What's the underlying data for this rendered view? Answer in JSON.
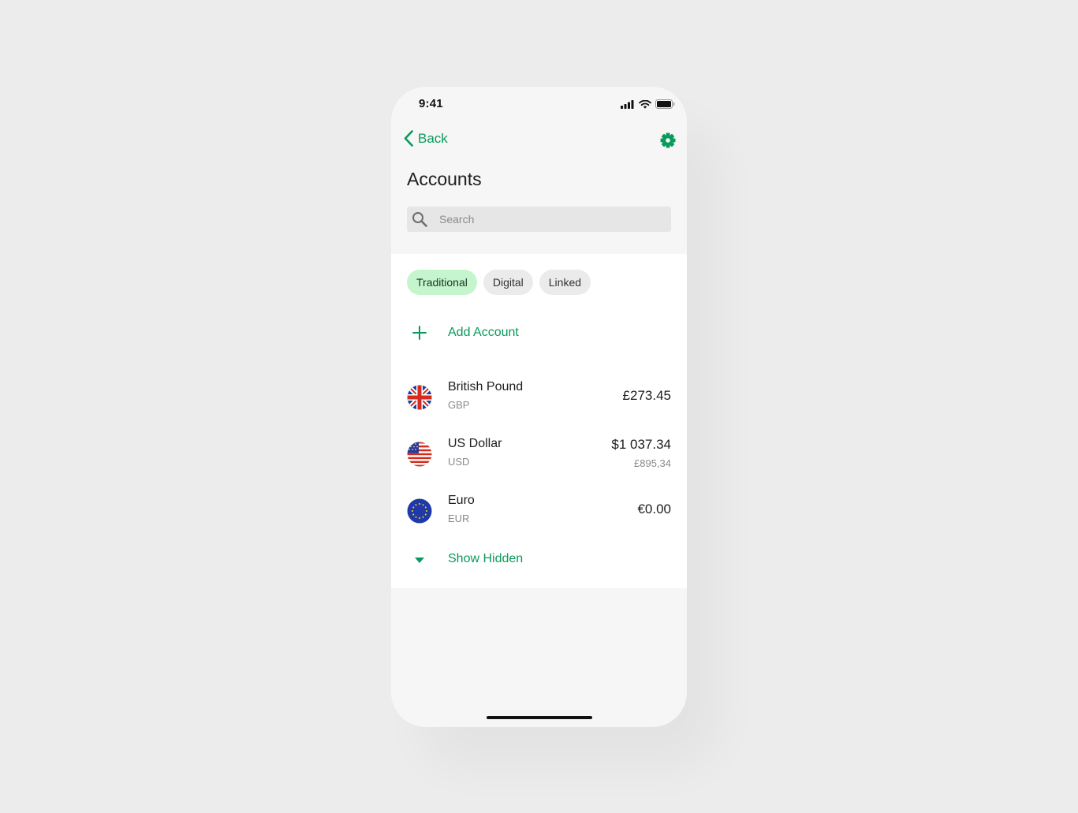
{
  "status_bar": {
    "time": "9:41",
    "icons": [
      "cellular-signal-icon",
      "wifi-icon",
      "battery-icon"
    ]
  },
  "nav": {
    "back_label": "Back",
    "back_icon": "chevron-left-icon",
    "settings_icon": "gear-icon"
  },
  "page": {
    "title": "Accounts"
  },
  "search": {
    "placeholder": "Search",
    "value": "",
    "icon": "search-icon"
  },
  "filters": {
    "chips": [
      {
        "label": "Traditional",
        "selected": true
      },
      {
        "label": "Digital",
        "selected": false
      },
      {
        "label": "Linked",
        "selected": false
      }
    ]
  },
  "add_account": {
    "label": "Add Account",
    "icon": "plus-icon"
  },
  "accounts": [
    {
      "name": "British Pound",
      "code": "GBP",
      "amount": "£273.45",
      "secondary": "",
      "flag": "uk-flag-icon"
    },
    {
      "name": "US Dollar",
      "code": "USD",
      "amount": "$1 037.34",
      "secondary": "£895,34",
      "flag": "us-flag-icon"
    },
    {
      "name": "Euro",
      "code": "EUR",
      "amount": "€0.00",
      "secondary": "",
      "flag": "eu-flag-icon"
    }
  ],
  "show_hidden": {
    "label": "Show Hidden",
    "icon": "caret-down-icon"
  },
  "colors": {
    "accent": "#0a9a5b",
    "chip_active_bg": "#c4f5cc",
    "page_bg": "#ececec",
    "phone_bg": "#f6f6f6"
  }
}
